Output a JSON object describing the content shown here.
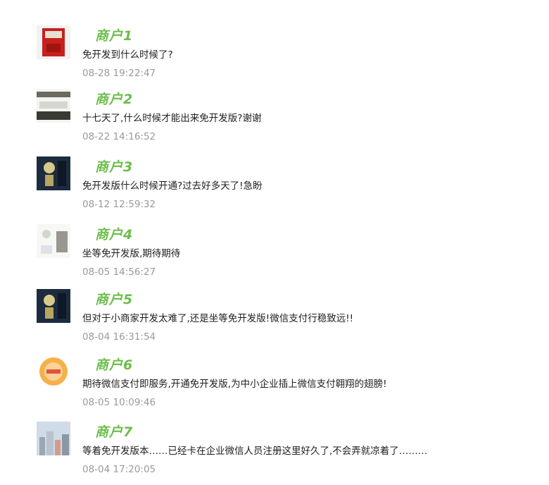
{
  "comments": [
    {
      "name": "商户1",
      "text": "免开发到什么时候了?",
      "time": "08-28 19:22:47"
    },
    {
      "name": "商户2",
      "text": "十七天了,什么时候才能出来免开发版?谢谢",
      "time": "08-22 14:16:52"
    },
    {
      "name": "商户3",
      "text": "免开发版什么时候开通?过去好多天了!急盼",
      "time": "08-12 12:59:32"
    },
    {
      "name": "商户4",
      "text": "坐等免开发版,期待期待",
      "time": "08-05 14:56:27"
    },
    {
      "name": "商户5",
      "text": "但对于小商家开发太难了,还是坐等免开发版!微信支付行稳致远!!",
      "time": "08-04 16:31:54"
    },
    {
      "name": "商户6",
      "text": "期待微信支付即服务,开通免开发版,为中小企业插上微信支付翱翔的翅膀!",
      "time": "08-05 10:09:46"
    },
    {
      "name": "商户7",
      "text": "等着免开发版本……已经卡在企业微信人员注册这里好久了,不会弄就凉着了………",
      "time": "08-04 17:20:05"
    }
  ],
  "colors": {
    "name": "#6bbd4a",
    "text": "#1f1f1f",
    "time": "#9a9a9a"
  },
  "avatar_icons": [
    "red-box-avatar-icon",
    "landscape-avatar-icon",
    "night-figure-avatar-icon",
    "sketch-avatar-icon",
    "night-figure-avatar-icon",
    "round-logo-avatar-icon",
    "city-photo-avatar-icon"
  ]
}
